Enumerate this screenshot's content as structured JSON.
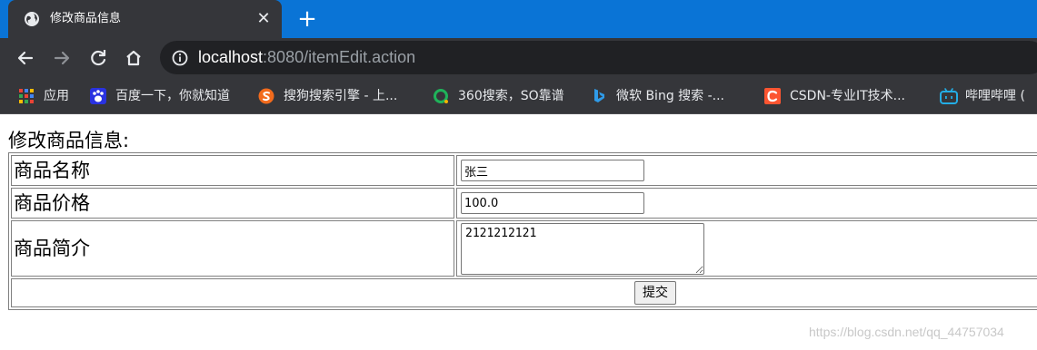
{
  "browser": {
    "tab": {
      "title": "修改商品信息",
      "favicon": "globe-icon",
      "close_glyph": "✕"
    },
    "new_tab_glyph": "+",
    "toolbar": {
      "back_icon": "back-arrow-icon",
      "forward_icon": "forward-arrow-icon",
      "reload_icon": "reload-icon",
      "home_icon": "home-icon",
      "url_host": "localhost",
      "url_rest": ":8080/itemEdit.action"
    },
    "bookmarks": [
      {
        "label": "应用",
        "icon": "apps-grid-icon"
      },
      {
        "label": "百度一下，你就知道",
        "icon": "baidu-icon"
      },
      {
        "label": "搜狗搜索引擎 - 上...",
        "icon": "sogou-icon"
      },
      {
        "label": "360搜索，SO靠谱",
        "icon": "so360-icon"
      },
      {
        "label": "微软 Bing 搜索 -...",
        "icon": "bing-icon"
      },
      {
        "label": "CSDN-专业IT技术...",
        "icon": "csdn-icon"
      },
      {
        "label": "哔哩哔哩 (",
        "icon": "bilibili-icon"
      }
    ]
  },
  "form": {
    "title": "修改商品信息:",
    "fields": [
      {
        "label": "商品名称",
        "value": "张三"
      },
      {
        "label": "商品价格",
        "value": "100.0"
      },
      {
        "label": "商品简介",
        "value": "2121212121"
      }
    ],
    "submit_label": "提交"
  },
  "watermark": "https://blog.csdn.net/qq_44757034",
  "colors": {
    "tabstrip": "#0a74d6",
    "toolbar": "#35363a",
    "omnibox": "#202124"
  }
}
